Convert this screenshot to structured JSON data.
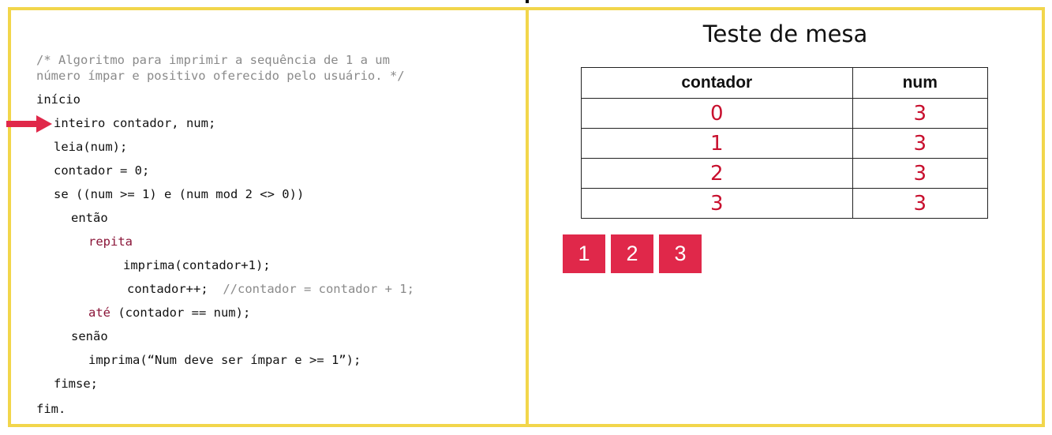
{
  "code": {
    "comment_line1": "/* Algoritmo para imprimir a sequência de 1 a um",
    "comment_line2": "número ímpar e positivo oferecido pelo usuário. */",
    "line_inicio": "início",
    "line_declare": "inteiro contador, num;",
    "line_leia": "leia(num);",
    "line_init": "contador = 0;",
    "line_se": "se ((num >= 1) e (num mod 2 <> 0))",
    "line_entao": "então",
    "kw_repita": "repita",
    "line_imprima": "imprima(contador+1);",
    "line_incr": "contador++;",
    "line_incr_comment": "//contador = contador + 1;",
    "kw_ate": "até",
    "line_ate_cond": " (contador == num);",
    "line_senao": "senão",
    "line_imprima_err": "imprima(“Num deve ser ímpar e >= 1”);",
    "line_fimse": "fimse;",
    "line_fim": "fim."
  },
  "trace": {
    "title": "Teste de mesa",
    "headers": [
      "contador",
      "num"
    ],
    "rows": [
      [
        "0",
        "3"
      ],
      [
        "1",
        "3"
      ],
      [
        "2",
        "3"
      ],
      [
        "3",
        "3"
      ]
    ]
  },
  "output": [
    "1",
    "2",
    "3"
  ],
  "colors": {
    "border": "#f2d64b",
    "arrow": "#e0284a",
    "keyword": "#8a1538",
    "table_values": "#c8102e",
    "output_box": "#e0284a"
  },
  "icons": {
    "current_line_pointer": "arrow-right-icon"
  }
}
